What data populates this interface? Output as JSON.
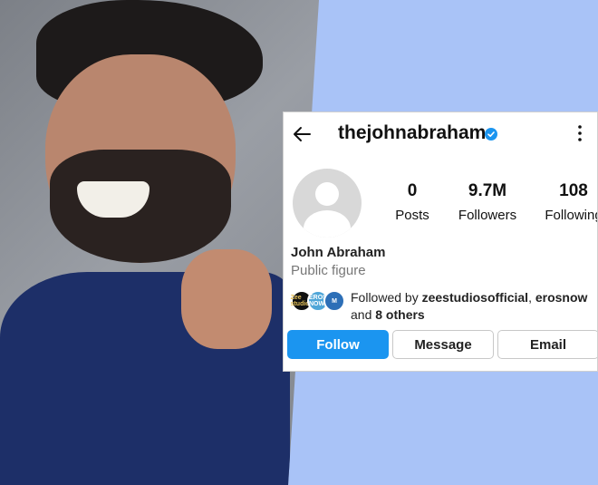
{
  "profile": {
    "username": "thejohnabraham",
    "stats": [
      {
        "value": "0",
        "label": "Posts"
      },
      {
        "value": "9.7M",
        "label": "Followers"
      },
      {
        "value": "108",
        "label": "Following"
      }
    ],
    "name": "John Abraham",
    "category": "Public figure",
    "followed_by_prefix": "Followed by ",
    "followed_by_users": "zeestudiosofficial",
    "followed_by_sep": ", ",
    "followed_by_more_user": "erosnow",
    "followed_by_and": "and ",
    "followed_by_others": "8 others",
    "follower_avatar_texts": [
      "Zee studios",
      "EROS NOW",
      "M"
    ]
  },
  "buttons": {
    "follow": "Follow",
    "message": "Message",
    "email": "Email"
  },
  "colors": {
    "accent": "#1b95f0",
    "background_right": "#a9c3f7",
    "shirt": "#1d2f68"
  },
  "icons": [
    "back-arrow-icon",
    "verified-badge-icon",
    "more-options-icon",
    "default-avatar-icon"
  ]
}
